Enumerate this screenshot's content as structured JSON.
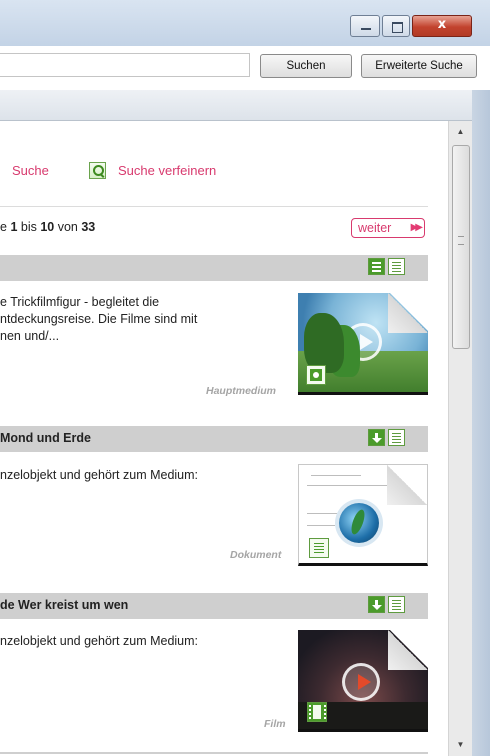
{
  "window": {
    "minimize_glyph": "",
    "maximize_glyph": "",
    "close_glyph": "x"
  },
  "toolbar": {
    "search_value": "",
    "search_button": "Suchen",
    "advanced_button": "Erweiterte Suche"
  },
  "search_links": {
    "partial_label": "Suche",
    "refine_label": "Suche verfeinern"
  },
  "pager": {
    "prefix": "e ",
    "from": "1",
    "mid1": " bis ",
    "to": "10",
    "mid2": " von ",
    "total": "33",
    "next_label": "weiter",
    "next_arrows": "▶▶"
  },
  "results": [
    {
      "title": "",
      "description": "e Trickfilmfigur - begleitet die\nntdeckungsreise. Die Filme sind mit\nnen und/...",
      "media_type": "Hauptmedium",
      "badge": "cd-icon"
    },
    {
      "title": "Mond und Erde",
      "description": "nzelobjekt und gehört zum Medium:",
      "media_type": "Dokument",
      "badge": "document-icon"
    },
    {
      "title": "de Wer kreist um wen",
      "description": "nzelobjekt und gehört zum Medium:",
      "media_type": "Film",
      "badge": "film-icon"
    }
  ],
  "colors": {
    "accent": "#d83a6e",
    "green": "#4b9b2b",
    "row_header": "#cfcfcf"
  }
}
